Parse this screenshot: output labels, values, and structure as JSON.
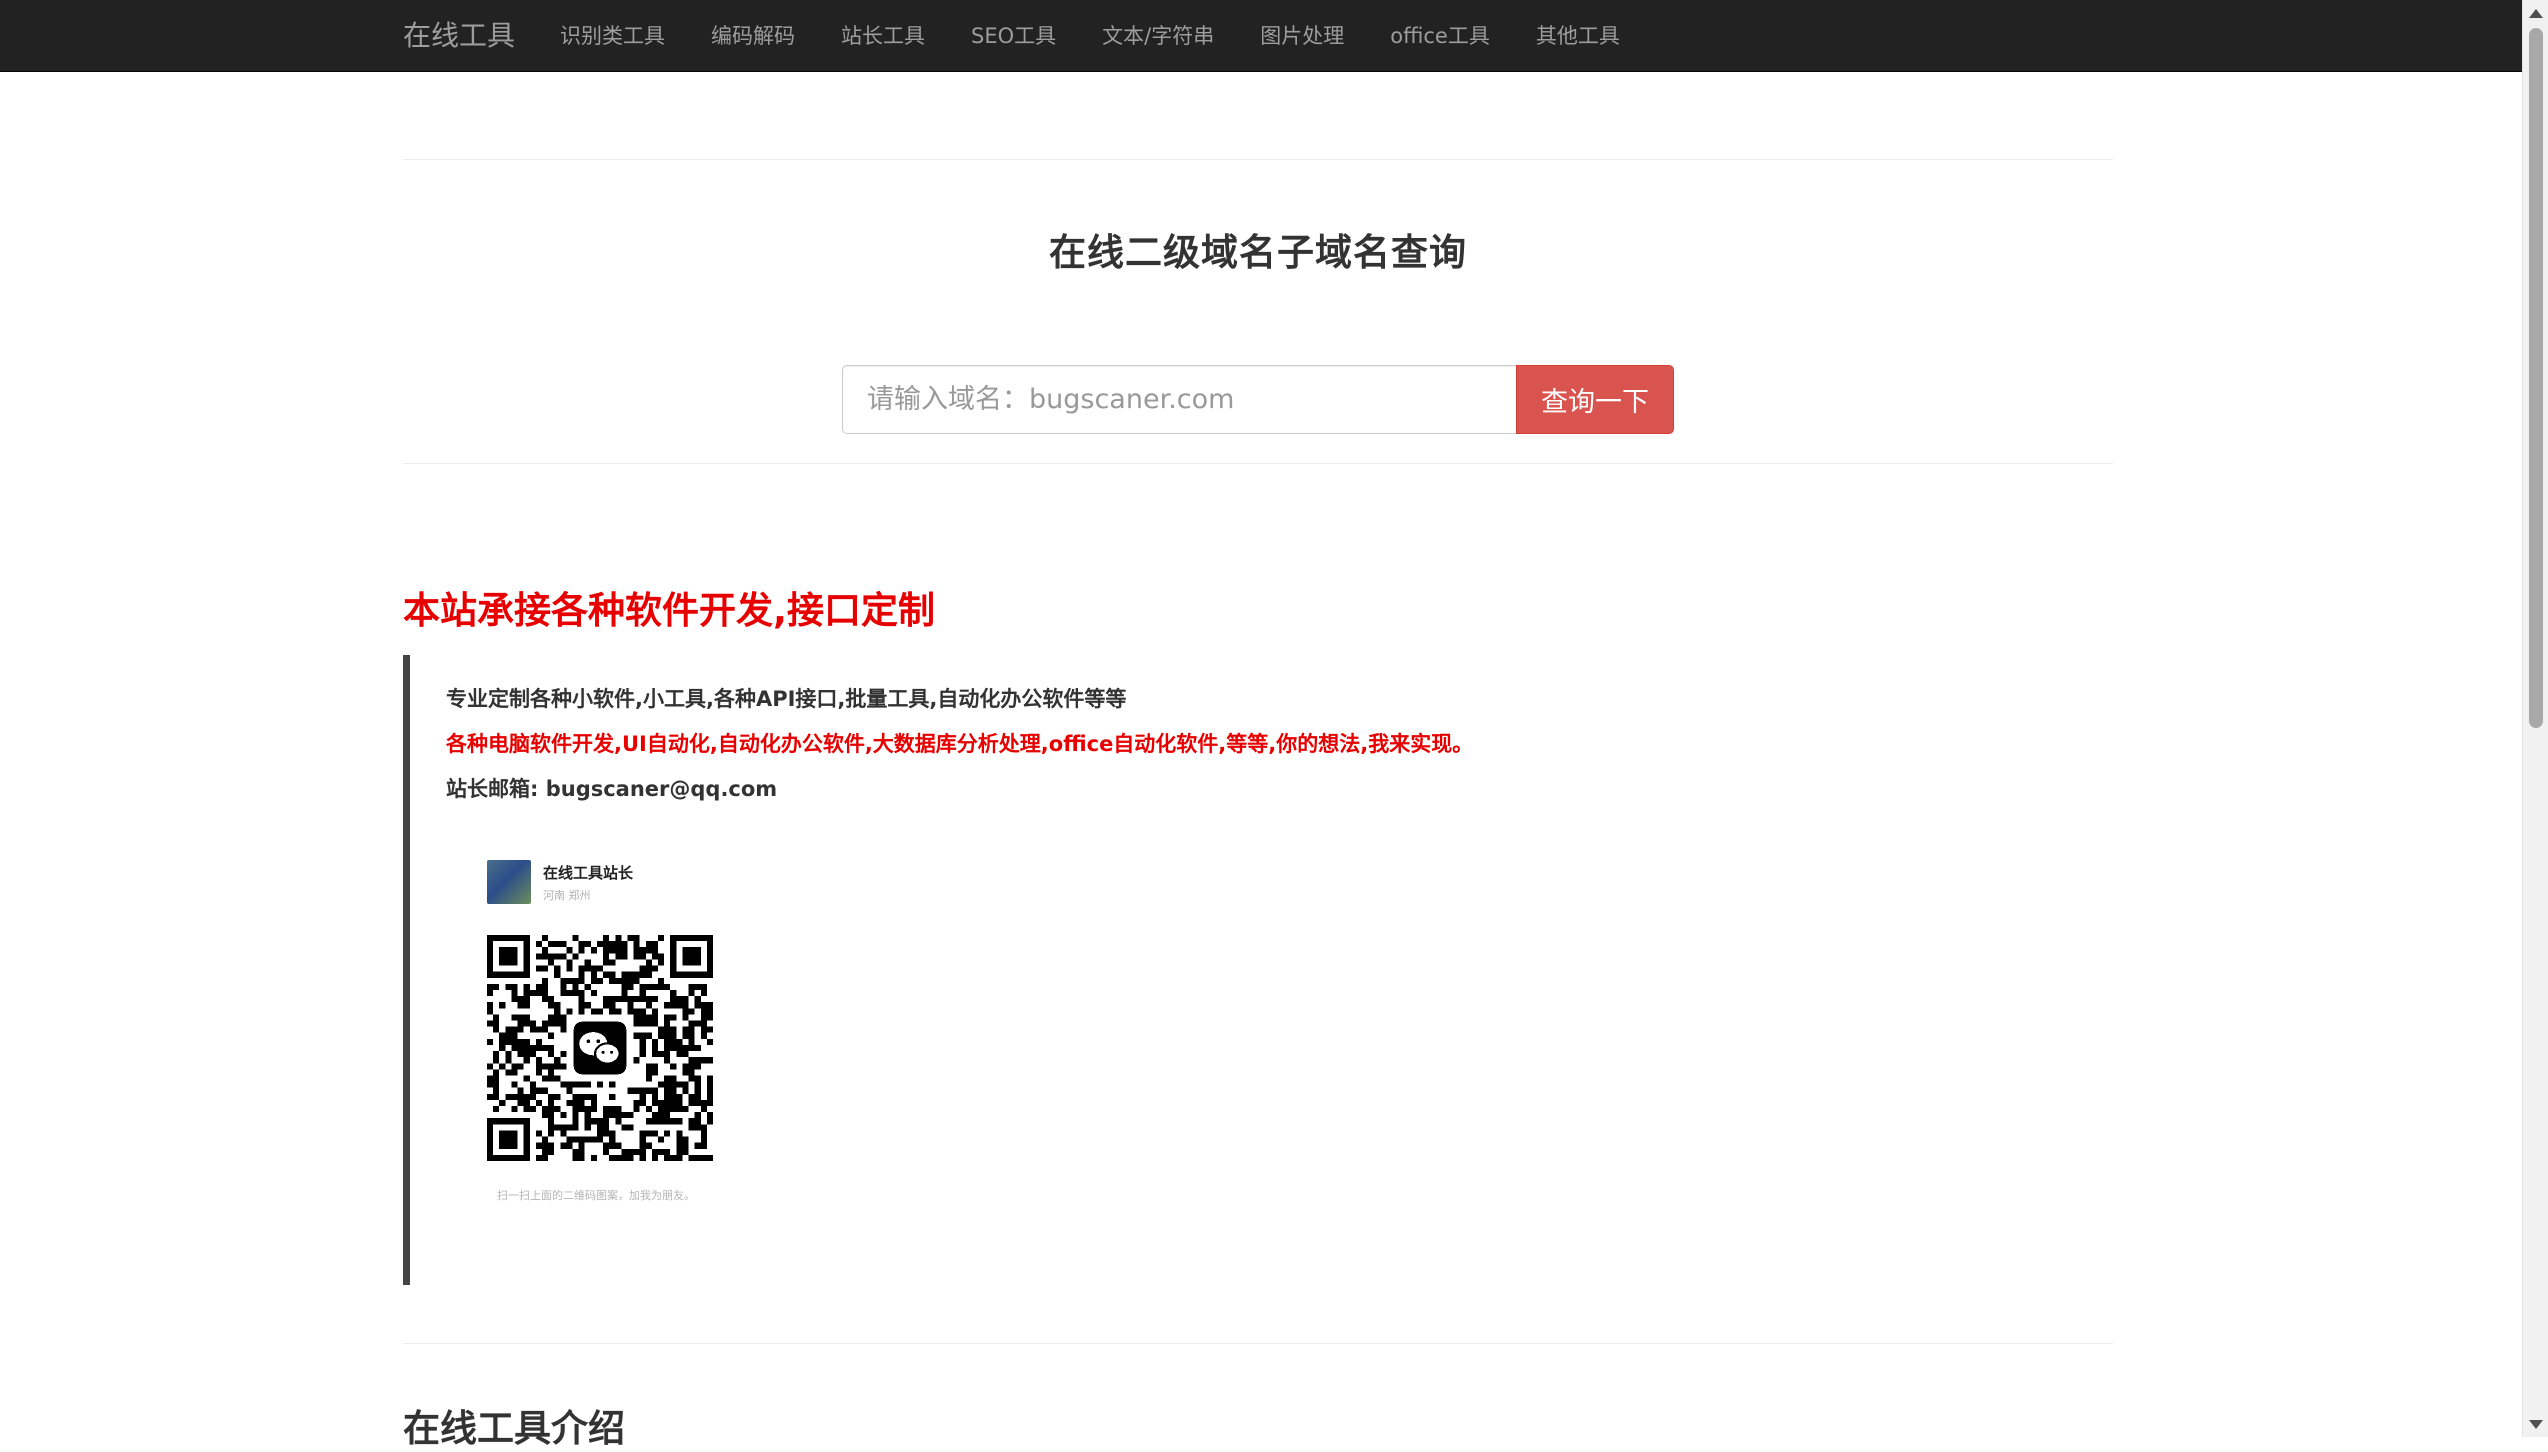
{
  "navbar": {
    "brand": "在线工具",
    "items": [
      {
        "label": "识别类工具"
      },
      {
        "label": "编码解码"
      },
      {
        "label": "站长工具"
      },
      {
        "label": "SEO工具"
      },
      {
        "label": "文本/字符串"
      },
      {
        "label": "图片处理"
      },
      {
        "label": "office工具"
      },
      {
        "label": "其他工具"
      }
    ]
  },
  "main": {
    "title": "在线二级域名子域名查询",
    "search": {
      "placeholder": "请输入域名：bugscaner.com",
      "value": "",
      "button_label": "查询一下"
    },
    "promo": {
      "heading": "本站承接各种软件开发,接口定制",
      "line1": "专业定制各种小软件,小工具,各种API接口,批量工具,自动化办公软件等等",
      "line2": "各种电脑软件开发,UI自动化,自动化办公软件,大数据库分析处理,office自动化软件,等等,你的想法,我来实现。",
      "line3": "站长邮箱: bugscaner@qq.com",
      "qr_card": {
        "name": "在线工具站长",
        "region": "河南 郑州",
        "caption": "扫一扫上面的二维码图案，加我为朋友。",
        "icon": "wechat-icon"
      }
    },
    "intro_title": "在线工具介绍"
  },
  "colors": {
    "navbar_bg": "#222222",
    "nav_text": "#9d9d9d",
    "accent_red": "#e60000",
    "button_red": "#d9534f"
  }
}
